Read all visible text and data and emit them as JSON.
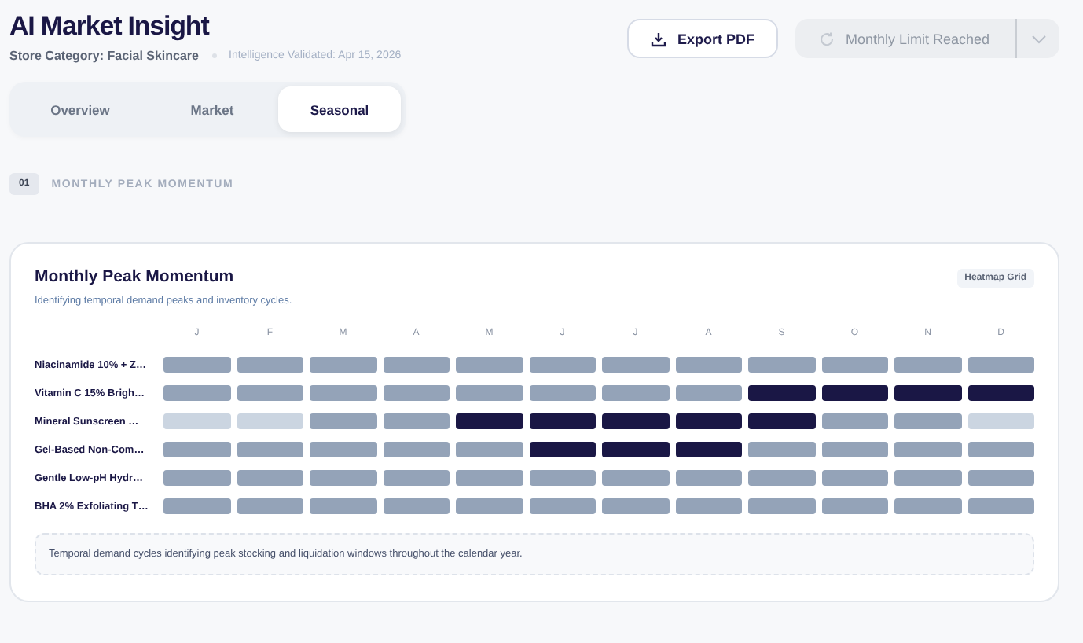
{
  "header": {
    "title": "AI Market Insight",
    "store_category": "Store Category: Facial Skincare",
    "validated": "Intelligence Validated: Apr 15, 2026"
  },
  "actions": {
    "export": {
      "label": "Export PDF"
    },
    "limit": {
      "label": "Monthly Limit Reached",
      "disabled": true
    }
  },
  "tabs": [
    {
      "label": "Overview",
      "selected": false
    },
    {
      "label": "Market",
      "selected": false
    },
    {
      "label": "Seasonal",
      "selected": true
    }
  ],
  "section": {
    "number": "01",
    "title": "MONTHLY PEAK MOMENTUM"
  },
  "card": {
    "title": "Monthly Peak Momentum",
    "subtitle": "Identifying temporal demand peaks and inventory cycles.",
    "badge": "Heatmap Grid",
    "months": [
      "J",
      "F",
      "M",
      "A",
      "M",
      "J",
      "J",
      "A",
      "S",
      "O",
      "N",
      "D"
    ],
    "rows": [
      {
        "name": "Niacinamide 10% + Z…",
        "cells": [
          {
            "color": "#94a3b8"
          },
          {
            "color": "#94a3b8"
          },
          {
            "color": "#94a3b8"
          },
          {
            "color": "#94a3b8"
          },
          {
            "color": "#94a3b8"
          },
          {
            "color": "#94a3b8"
          },
          {
            "color": "#94a3b8"
          },
          {
            "color": "#94a3b8"
          },
          {
            "color": "#94a3b8"
          },
          {
            "color": "#94a3b8"
          },
          {
            "color": "#94a3b8"
          },
          {
            "color": "#94a3b8"
          }
        ]
      },
      {
        "name": "Vitamin C 15% Brigh…",
        "cells": [
          {
            "color": "#94a3b8"
          },
          {
            "color": "#94a3b8"
          },
          {
            "color": "#94a3b8"
          },
          {
            "color": "#94a3b8"
          },
          {
            "color": "#94a3b8"
          },
          {
            "color": "#94a3b8"
          },
          {
            "color": "#94a3b8"
          },
          {
            "color": "#94a3b8"
          },
          {
            "color": "#1a1745"
          },
          {
            "color": "#1a1745"
          },
          {
            "color": "#1a1745"
          },
          {
            "color": "#1a1745"
          }
        ]
      },
      {
        "name": "Mineral Sunscreen …",
        "cells": [
          {
            "color": "#cbd5e1"
          },
          {
            "color": "#cbd5e1"
          },
          {
            "color": "#94a3b8"
          },
          {
            "color": "#94a3b8"
          },
          {
            "color": "#1a1745"
          },
          {
            "color": "#1a1745"
          },
          {
            "color": "#1a1745"
          },
          {
            "color": "#1a1745"
          },
          {
            "color": "#1a1745"
          },
          {
            "color": "#94a3b8"
          },
          {
            "color": "#94a3b8"
          },
          {
            "color": "#cbd5e1"
          }
        ]
      },
      {
        "name": "Gel-Based Non-Com…",
        "cells": [
          {
            "color": "#94a3b8"
          },
          {
            "color": "#94a3b8"
          },
          {
            "color": "#94a3b8"
          },
          {
            "color": "#94a3b8"
          },
          {
            "color": "#94a3b8"
          },
          {
            "color": "#1a1745"
          },
          {
            "color": "#1a1745"
          },
          {
            "color": "#1a1745"
          },
          {
            "color": "#94a3b8"
          },
          {
            "color": "#94a3b8"
          },
          {
            "color": "#94a3b8"
          },
          {
            "color": "#94a3b8"
          }
        ]
      },
      {
        "name": "Gentle Low-pH Hydr…",
        "cells": [
          {
            "color": "#94a3b8"
          },
          {
            "color": "#94a3b8"
          },
          {
            "color": "#94a3b8"
          },
          {
            "color": "#94a3b8"
          },
          {
            "color": "#94a3b8"
          },
          {
            "color": "#94a3b8"
          },
          {
            "color": "#94a3b8"
          },
          {
            "color": "#94a3b8"
          },
          {
            "color": "#94a3b8"
          },
          {
            "color": "#94a3b8"
          },
          {
            "color": "#94a3b8"
          },
          {
            "color": "#94a3b8"
          }
        ]
      },
      {
        "name": "BHA 2% Exfoliating T…",
        "cells": [
          {
            "color": "#94a3b8"
          },
          {
            "color": "#94a3b8"
          },
          {
            "color": "#94a3b8"
          },
          {
            "color": "#94a3b8"
          },
          {
            "color": "#94a3b8"
          },
          {
            "color": "#94a3b8"
          },
          {
            "color": "#94a3b8"
          },
          {
            "color": "#94a3b8"
          },
          {
            "color": "#94a3b8"
          },
          {
            "color": "#94a3b8"
          },
          {
            "color": "#94a3b8"
          },
          {
            "color": "#94a3b8"
          }
        ]
      }
    ],
    "note": "Temporal demand cycles identifying peak stocking and liquidation windows throughout the calendar year."
  }
}
